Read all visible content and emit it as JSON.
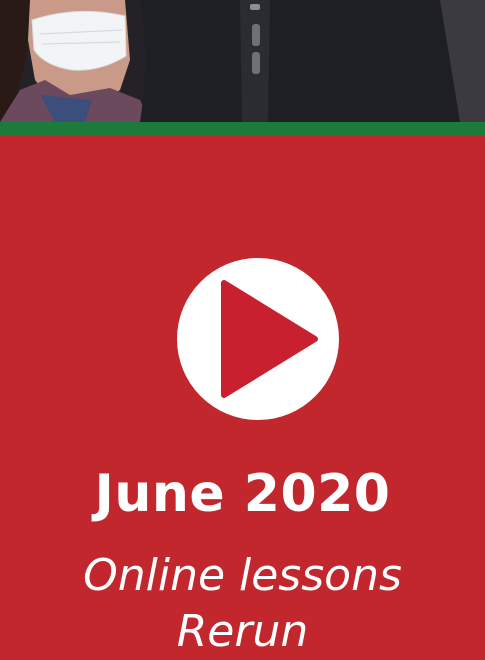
{
  "colors": {
    "panel_red": "#c1272d",
    "stripe_green": "#1c7a3a",
    "play_triangle": "#c8202f",
    "text": "#ffffff"
  },
  "hero": {
    "icon": "play-icon",
    "title": "June 2020",
    "subtitle_line1": "Online lessons",
    "subtitle_line2": "Rerun"
  }
}
